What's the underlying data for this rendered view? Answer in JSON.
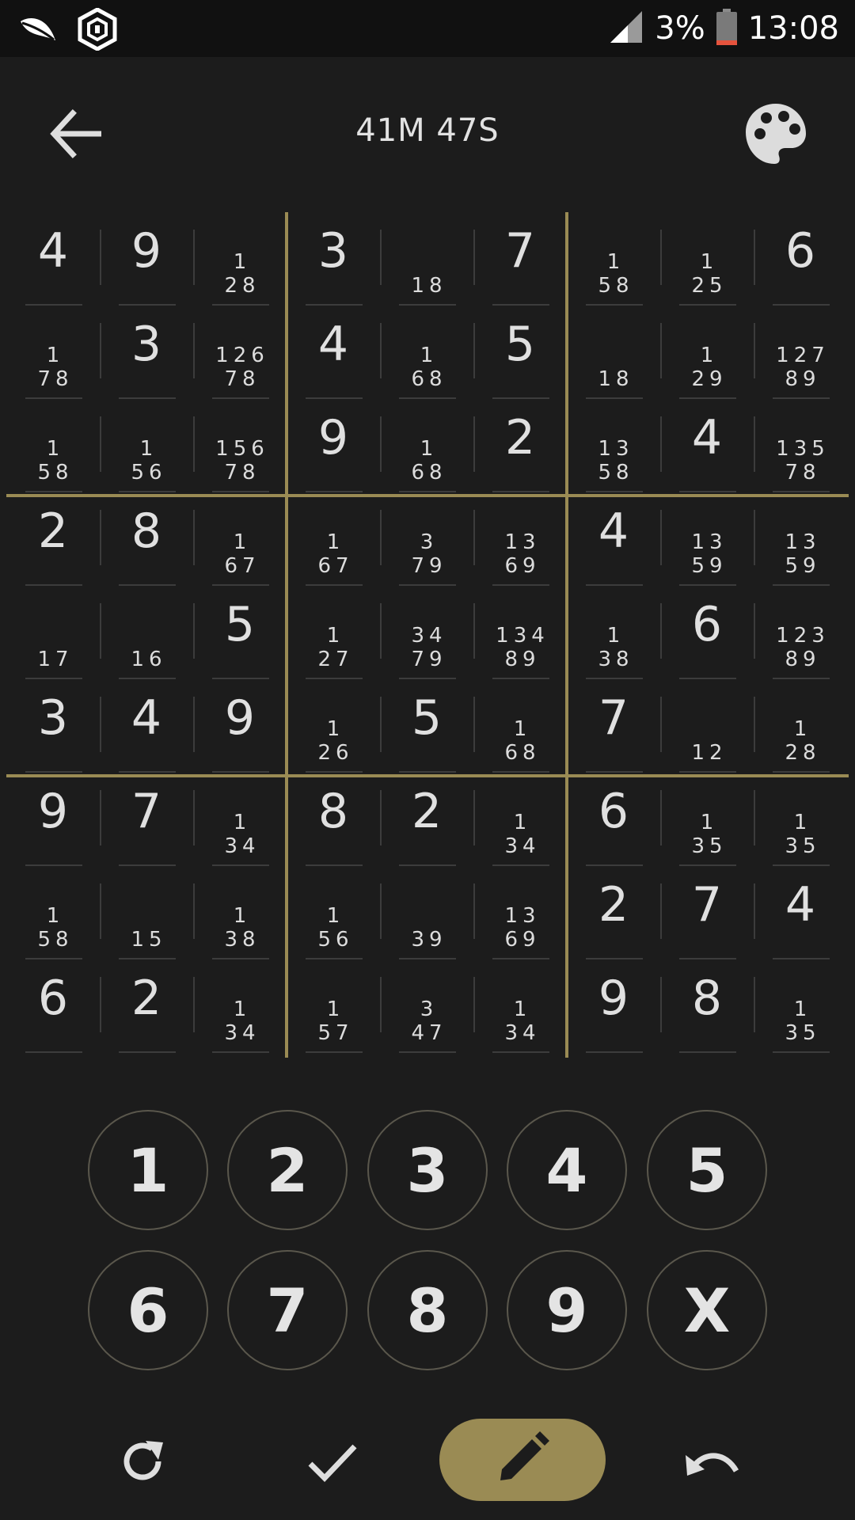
{
  "status_bar": {
    "battery_pct": "3%",
    "time": "13:08",
    "icons": [
      "leaf-icon",
      "hex-app-icon",
      "signal-icon",
      "battery-icon"
    ]
  },
  "header": {
    "timer": "41M 47S",
    "icons": [
      "arrow-back-icon",
      "palette-icon"
    ]
  },
  "board": {
    "rows": [
      [
        {
          "v": "4"
        },
        {
          "v": "9"
        },
        {
          "n": [
            "1",
            "28"
          ]
        },
        {
          "v": "3"
        },
        {
          "n": [
            "",
            "18"
          ]
        },
        {
          "v": "7"
        },
        {
          "n": [
            "1",
            "58"
          ]
        },
        {
          "n": [
            "1",
            "25"
          ]
        },
        {
          "v": "6"
        }
      ],
      [
        {
          "n": [
            "1",
            "78"
          ]
        },
        {
          "v": "3"
        },
        {
          "n": [
            "126",
            "78"
          ]
        },
        {
          "v": "4"
        },
        {
          "n": [
            "1",
            "68"
          ]
        },
        {
          "v": "5"
        },
        {
          "n": [
            "",
            "18"
          ]
        },
        {
          "n": [
            "1",
            "29"
          ]
        },
        {
          "n": [
            "127",
            "89"
          ]
        }
      ],
      [
        {
          "n": [
            "1",
            "58"
          ]
        },
        {
          "n": [
            "1",
            "56"
          ]
        },
        {
          "n": [
            "156",
            "78"
          ]
        },
        {
          "v": "9"
        },
        {
          "n": [
            "1",
            "68"
          ]
        },
        {
          "v": "2"
        },
        {
          "n": [
            "13",
            "58"
          ]
        },
        {
          "v": "4"
        },
        {
          "n": [
            "135",
            "78"
          ]
        }
      ],
      [
        {
          "v": "2"
        },
        {
          "v": "8"
        },
        {
          "n": [
            "1",
            "67"
          ]
        },
        {
          "n": [
            "1",
            "67"
          ]
        },
        {
          "n": [
            "3",
            "79"
          ]
        },
        {
          "n": [
            "13",
            "69"
          ]
        },
        {
          "v": "4"
        },
        {
          "n": [
            "13",
            "59"
          ]
        },
        {
          "n": [
            "13",
            "59"
          ]
        }
      ],
      [
        {
          "n": [
            "",
            "17"
          ]
        },
        {
          "n": [
            "",
            "16"
          ]
        },
        {
          "v": "5"
        },
        {
          "n": [
            "1",
            "27"
          ]
        },
        {
          "n": [
            "34",
            "79"
          ]
        },
        {
          "n": [
            "134",
            "89"
          ]
        },
        {
          "n": [
            "1",
            "38"
          ]
        },
        {
          "v": "6"
        },
        {
          "n": [
            "123",
            "89"
          ]
        }
      ],
      [
        {
          "v": "3"
        },
        {
          "v": "4"
        },
        {
          "v": "9"
        },
        {
          "n": [
            "1",
            "26"
          ]
        },
        {
          "v": "5"
        },
        {
          "n": [
            "1",
            "68"
          ]
        },
        {
          "v": "7"
        },
        {
          "n": [
            "",
            "12"
          ]
        },
        {
          "n": [
            "1",
            "28"
          ]
        }
      ],
      [
        {
          "v": "9"
        },
        {
          "v": "7"
        },
        {
          "n": [
            "1",
            "34"
          ]
        },
        {
          "v": "8"
        },
        {
          "v": "2"
        },
        {
          "n": [
            "1",
            "34"
          ]
        },
        {
          "v": "6"
        },
        {
          "n": [
            "1",
            "35"
          ]
        },
        {
          "n": [
            "1",
            "35"
          ]
        }
      ],
      [
        {
          "n": [
            "1",
            "58"
          ]
        },
        {
          "n": [
            "",
            "15"
          ]
        },
        {
          "n": [
            "1",
            "38"
          ]
        },
        {
          "n": [
            "1",
            "56"
          ]
        },
        {
          "n": [
            "",
            "39"
          ]
        },
        {
          "n": [
            "13",
            "69"
          ]
        },
        {
          "v": "2"
        },
        {
          "v": "7"
        },
        {
          "v": "4"
        }
      ],
      [
        {
          "v": "6"
        },
        {
          "v": "2"
        },
        {
          "n": [
            "1",
            "34"
          ]
        },
        {
          "n": [
            "1",
            "57"
          ]
        },
        {
          "n": [
            "3",
            "47"
          ]
        },
        {
          "n": [
            "1",
            "34"
          ]
        },
        {
          "v": "9"
        },
        {
          "v": "8"
        },
        {
          "n": [
            "1",
            "35"
          ]
        }
      ]
    ]
  },
  "numpad": [
    "1",
    "2",
    "3",
    "4",
    "5",
    "6",
    "7",
    "8",
    "9",
    "X"
  ],
  "toolbar": {
    "icons": [
      "refresh-icon",
      "check-icon",
      "pencil-icon",
      "undo-icon"
    ]
  },
  "colors": {
    "background": "#1c1c1c",
    "status_bar": "#111111",
    "accent": "#9a8b54",
    "grid_line": "#3c3c3c",
    "text": "#e0e0e0"
  }
}
